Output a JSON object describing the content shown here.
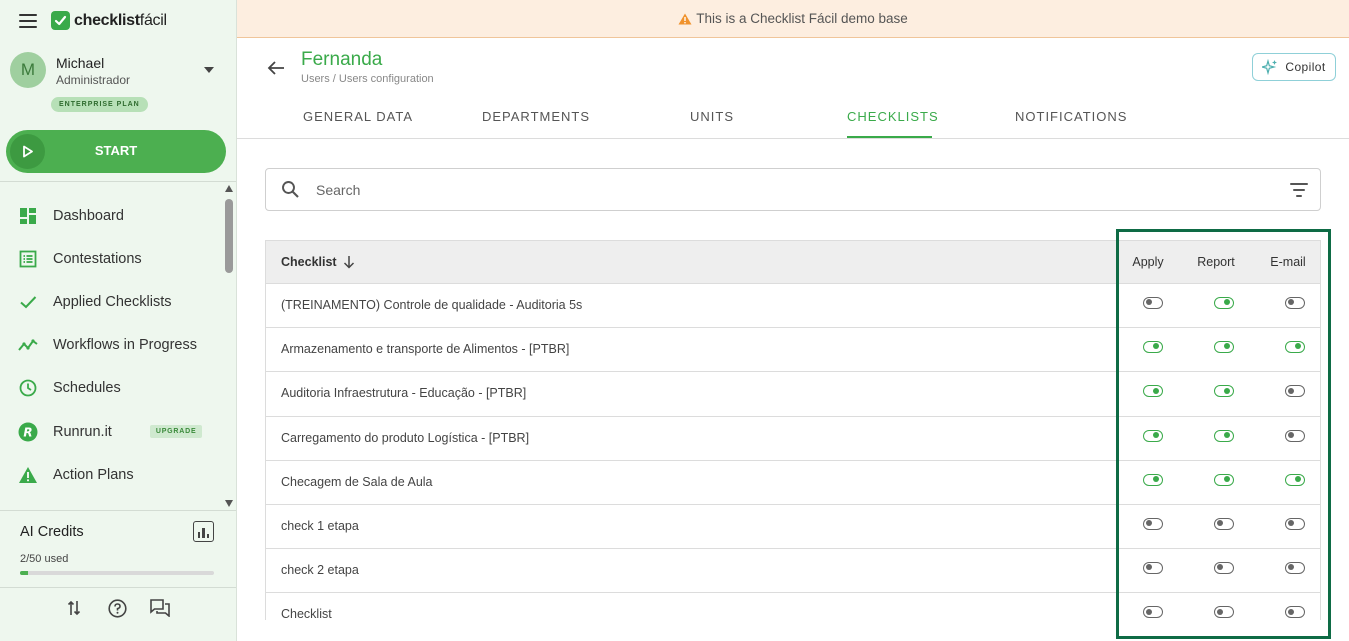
{
  "brand": {
    "name_bold": "checklist",
    "name_thin": "fácil"
  },
  "user": {
    "initial": "M",
    "name": "Michael",
    "role": "Administrador",
    "plan": "ENTERPRISE PLAN"
  },
  "start_label": "START",
  "nav": [
    {
      "label": "Dashboard",
      "icon": "dashboard-icon"
    },
    {
      "label": "Contestations",
      "icon": "list-icon"
    },
    {
      "label": "Applied Checklists",
      "icon": "check-icon"
    },
    {
      "label": "Workflows in Progress",
      "icon": "trend-icon"
    },
    {
      "label": "Schedules",
      "icon": "clock-icon"
    },
    {
      "label": "Runrun.it",
      "icon": "runrun-icon",
      "badge": "UPGRADE"
    },
    {
      "label": "Action Plans",
      "icon": "warning-icon"
    }
  ],
  "ai": {
    "title": "AI Credits",
    "used_label": "2/50 used",
    "used": 2,
    "total": 50
  },
  "banner": "This is a Checklist Fácil demo base",
  "header": {
    "title": "Fernanda",
    "crumb1": "Users /",
    "crumb2": "Users configuration",
    "copilot": "Copilot"
  },
  "tabs": [
    {
      "label": "GENERAL DATA",
      "active": false
    },
    {
      "label": "DEPARTMENTS",
      "active": false
    },
    {
      "label": "UNITS",
      "active": false
    },
    {
      "label": "CHECKLISTS",
      "active": true
    },
    {
      "label": "NOTIFICATIONS",
      "active": false
    }
  ],
  "search": {
    "placeholder": "Search"
  },
  "table": {
    "columns": {
      "checklist": "Checklist",
      "apply": "Apply",
      "report": "Report",
      "email": "E-mail"
    },
    "rows": [
      {
        "name": "(TREINAMENTO) Controle de qualidade - Auditoria 5s",
        "apply": false,
        "report": true,
        "email": false
      },
      {
        "name": "Armazenamento e transporte de Alimentos - [PTBR]",
        "apply": true,
        "report": true,
        "email": true
      },
      {
        "name": "Auditoria Infraestrutura - Educação - [PTBR]",
        "apply": true,
        "report": true,
        "email": false
      },
      {
        "name": "Carregamento do produto Logística - [PTBR]",
        "apply": true,
        "report": true,
        "email": false
      },
      {
        "name": "Checagem de Sala de Aula",
        "apply": true,
        "report": true,
        "email": true
      },
      {
        "name": "check 1 etapa",
        "apply": false,
        "report": false,
        "email": false
      },
      {
        "name": "check 2 etapa",
        "apply": false,
        "report": false,
        "email": false
      },
      {
        "name": "Checklist",
        "apply": false,
        "report": false,
        "email": false
      }
    ]
  },
  "colors": {
    "accent": "#3aaa4a",
    "highlight": "#0e6b45",
    "banner_bg": "#fdeee0"
  }
}
